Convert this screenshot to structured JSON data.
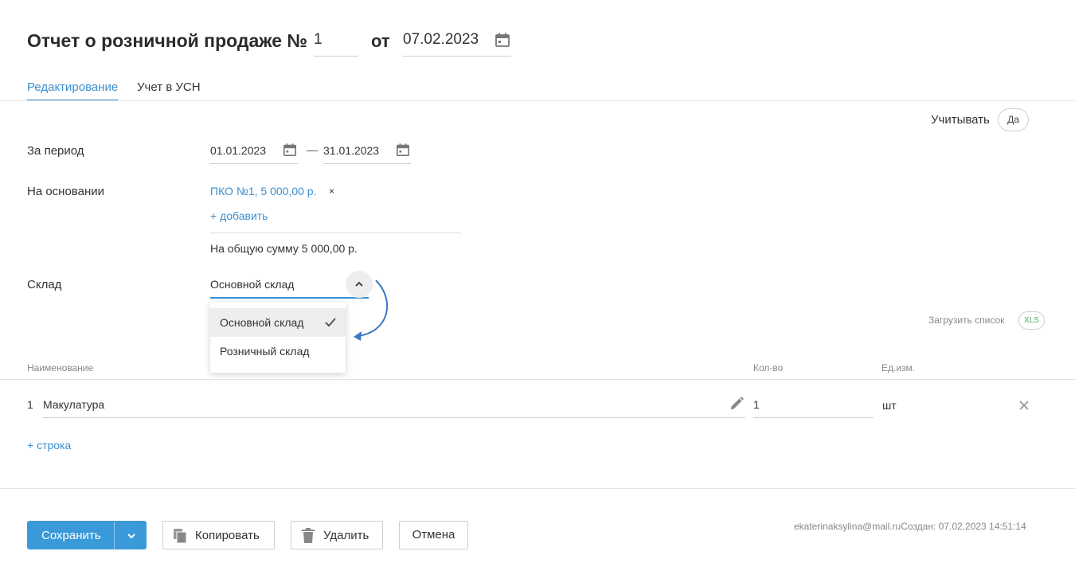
{
  "header": {
    "title": "Отчет о розничной продаже №",
    "number": "1",
    "from_label": "от",
    "date": "07.02.2023"
  },
  "tabs": [
    {
      "label": "Редактирование",
      "active": true
    },
    {
      "label": "Учет в УСН",
      "active": false
    }
  ],
  "account": {
    "label": "Учитывать",
    "value": "Да"
  },
  "period": {
    "label": "За период",
    "from": "01.01.2023",
    "separator": "—",
    "to": "31.01.2023"
  },
  "basis": {
    "label": "На основании",
    "document": "ПКО №1, 5 000,00 р.",
    "remove": "×",
    "add": "+ добавить",
    "total": "На общую сумму 5 000,00 р."
  },
  "warehouse": {
    "label": "Склад",
    "selected": "Основной склад",
    "options": [
      "Основной склад",
      "Розничный склад"
    ]
  },
  "load_list": {
    "label": "Загрузить список",
    "badge": "XLS"
  },
  "table": {
    "columns": [
      "Наименование",
      "Кол-во",
      "Ед.изм."
    ],
    "rows": [
      {
        "index": "1",
        "name": "Макулатура",
        "qty": "1",
        "unit": "шт"
      }
    ],
    "add_row": "+ строка"
  },
  "actions": {
    "save": "Сохранить",
    "copy": "Копировать",
    "delete": "Удалить",
    "cancel": "Отмена"
  },
  "footer": {
    "info": "ekaterinaksylina@mail.ruСоздан: 07.02.2023 14:51:14"
  },
  "colors": {
    "accent": "#3a8fd1",
    "primary_button": "#3a9ad9",
    "xls": "#4aa86b"
  },
  "icons": [
    "calendar-icon",
    "chevron-up-icon",
    "check-icon",
    "pencil-icon",
    "close-icon",
    "chevron-down-icon",
    "copy-icon",
    "trash-icon"
  ]
}
